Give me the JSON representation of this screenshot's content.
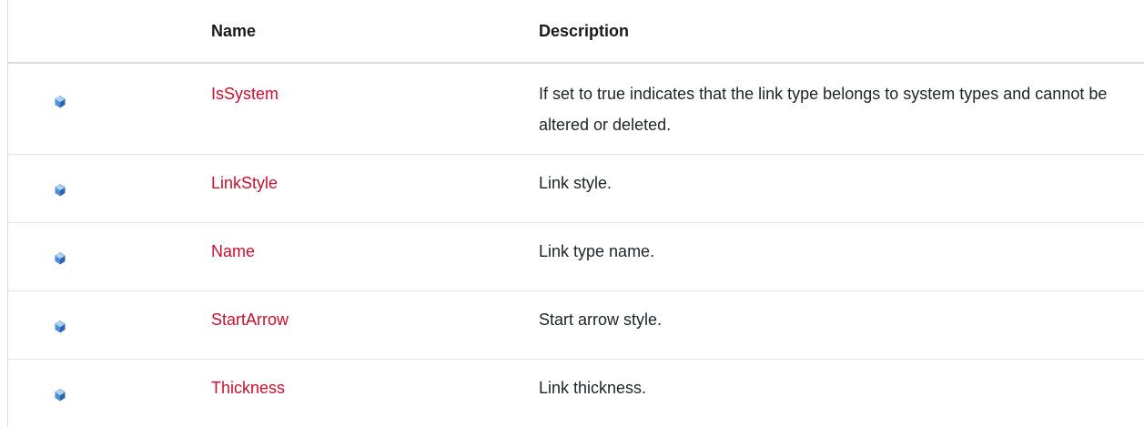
{
  "table": {
    "headers": {
      "icon": "",
      "name": "Name",
      "description": "Description"
    },
    "rows": [
      {
        "icon": "public-property-icon",
        "name": "IsSystem",
        "description": "If set to true indicates that the link type belongs to system types and cannot be altered or deleted."
      },
      {
        "icon": "public-property-icon",
        "name": "LinkStyle",
        "description": "Link style."
      },
      {
        "icon": "public-property-icon",
        "name": "Name",
        "description": "Link type name."
      },
      {
        "icon": "public-property-icon",
        "name": "StartArrow",
        "description": "Start arrow style."
      },
      {
        "icon": "public-property-icon",
        "name": "Thickness",
        "description": "Link thickness."
      }
    ]
  },
  "colors": {
    "link": "#c8102e",
    "icon_light": "#8fc0ee",
    "icon_dark": "#2e6fc2",
    "rule": "#e5e5e5"
  }
}
